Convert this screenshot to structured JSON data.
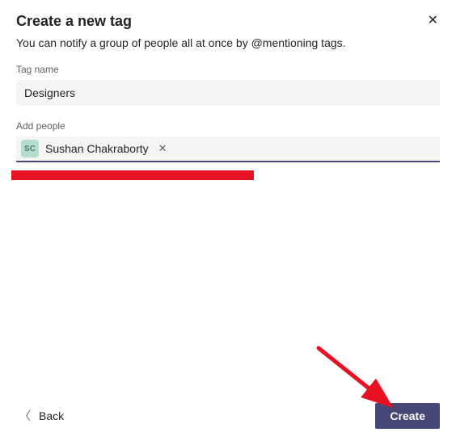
{
  "dialog": {
    "title": "Create a new tag",
    "subtitle": "You can notify a group of people all at once by @mentioning tags.",
    "tagNameLabel": "Tag name",
    "tagNameValue": "Designers",
    "addPeopleLabel": "Add people",
    "person": {
      "initials": "SC",
      "name": "Sushan Chakraborty"
    },
    "backLabel": "Back",
    "createLabel": "Create"
  },
  "annotations": {
    "redactionColor": "#E81123",
    "arrowColor": "#E81123"
  }
}
